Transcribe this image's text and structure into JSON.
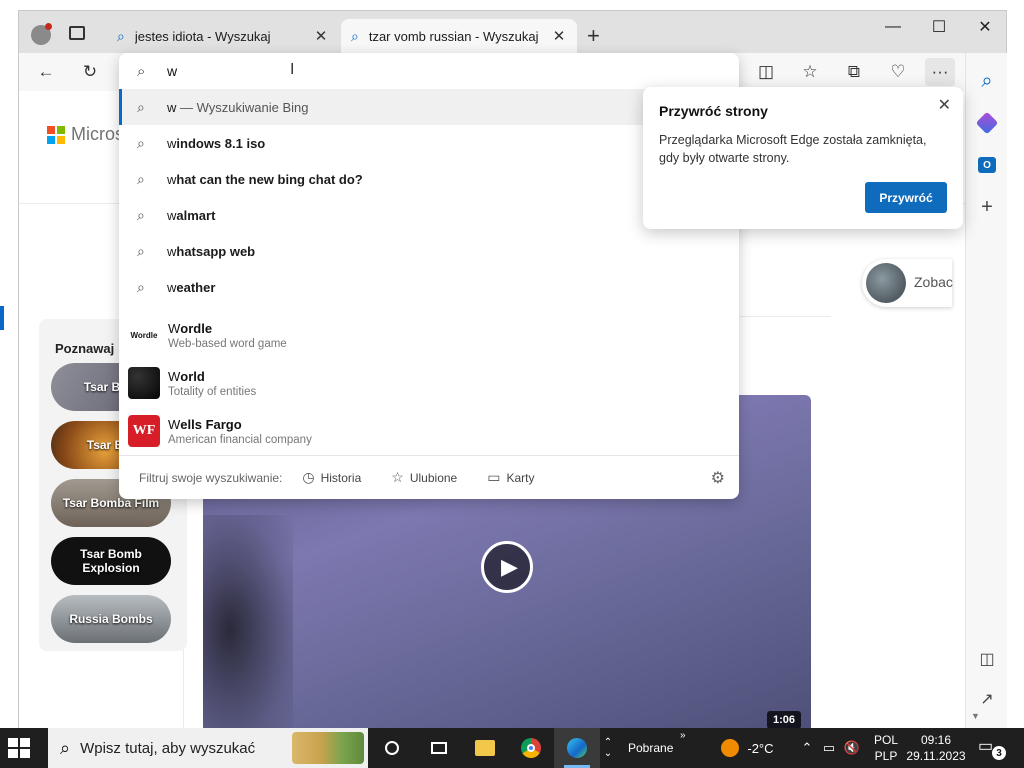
{
  "tabs": [
    {
      "title": "jestes idiota - Wyszukaj",
      "active": false
    },
    {
      "title": "tzar vomb russian - Wyszukaj",
      "active": true
    }
  ],
  "icons": {
    "search": "⌕",
    "close": "✕",
    "new_tab": "+",
    "back": "←",
    "refresh": "↻",
    "minimize": "—",
    "maximize": "☐",
    "split": "◫",
    "favorites": "☆",
    "collections": "⧉",
    "health": "♡",
    "more": "···",
    "gear": "⚙",
    "history": "◷",
    "tabs": "▭",
    "play": "▶"
  },
  "page": {
    "logo_text": "Microsc",
    "side_title": "Poznawaj",
    "pills": [
      "Tsar Bom",
      "Tsar Bor",
      "Tsar Bomba Film",
      "Tsar Bomb Explosion",
      "Russia Bombs"
    ],
    "right_card_label": "Zobac",
    "video_duration": "1:06"
  },
  "omnibox": {
    "value": "w",
    "suggestions": [
      {
        "typed": "w",
        "rest": " — Wyszukiwanie Bing",
        "selected": true,
        "rest_bold": false
      },
      {
        "typed": "w",
        "rest": "indows 8.1 iso",
        "selected": false,
        "rest_bold": true
      },
      {
        "typed": "w",
        "rest": "hat can the new bing chat do?",
        "selected": false,
        "rest_bold": true
      },
      {
        "typed": "w",
        "rest": "almart",
        "selected": false,
        "rest_bold": true
      },
      {
        "typed": "w",
        "rest": "hatsapp web",
        "selected": false,
        "rest_bold": true
      },
      {
        "typed": "w",
        "rest": "eather",
        "selected": false,
        "rest_bold": true
      }
    ],
    "entities": [
      {
        "typed": "W",
        "rest": "ordle",
        "desc": "Web-based word game",
        "thumb_text": "Wordle",
        "thumb_bg": "#ffffff",
        "thumb_fg": "#111111"
      },
      {
        "typed": "W",
        "rest": "orld",
        "desc": "Totality of entities",
        "thumb_text": "",
        "thumb_bg": "#0b0b0b",
        "thumb_fg": "#ffffff"
      },
      {
        "typed": "W",
        "rest": "ells Fargo",
        "desc": "American financial company",
        "thumb_text": "WF",
        "thumb_bg": "#d71e28",
        "thumb_fg": "#ffffff"
      }
    ],
    "filter_label": "Filtruj swoje wyszukiwanie:",
    "filter_buttons": [
      "Historia",
      "Ulubione",
      "Karty"
    ]
  },
  "restore_popup": {
    "title": "Przywróć strony",
    "message": "Przeglądarka Microsoft Edge została zamknięta, gdy były otwarte strony.",
    "button": "Przywróć"
  },
  "taskbar": {
    "search_placeholder": "Wpisz tutaj, aby wyszukać",
    "weather_label": "Pobrane",
    "temperature": "-2°C",
    "lang_top": "POL",
    "lang_bottom": "PLP",
    "time": "09:16",
    "date": "29.11.2023",
    "notifications": "3"
  },
  "colors": {
    "accent": "#0f6cbd",
    "wells_fargo": "#d71e28"
  }
}
